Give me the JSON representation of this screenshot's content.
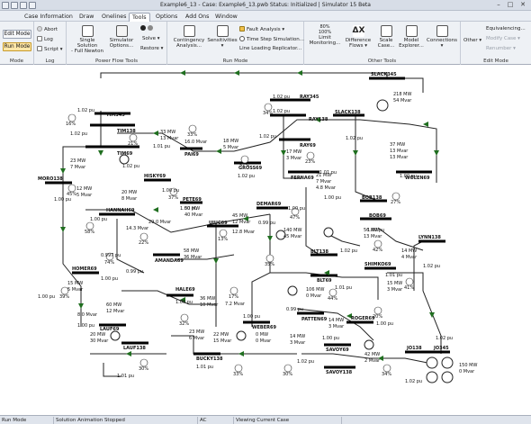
{
  "window": {
    "title": "Example6_13 - Case: Example6_13.pwb  Status: Initialized | Simulator 15 Beta",
    "minimize": "–",
    "maximize": "□",
    "close": "✕"
  },
  "menu": {
    "tabs": [
      {
        "label": "Case Information"
      },
      {
        "label": "Draw"
      },
      {
        "label": "Onelines"
      },
      {
        "label": "Tools"
      },
      {
        "label": "Options"
      },
      {
        "label": "Add Ons"
      },
      {
        "label": "Window"
      }
    ],
    "active": "Tools"
  },
  "ribbon": {
    "mode": {
      "edit": "Edit Mode",
      "run": "Run Mode",
      "group": "Mode"
    },
    "log": {
      "abort": "Abort",
      "log": "Log",
      "script": "Script",
      "group": "Log"
    },
    "powerflow": {
      "single_solution_l1": "Single Solution",
      "single_solution_l2": "- Full Newton",
      "simulator_l1": "Simulator",
      "simulator_l2": "Options...",
      "solve": "Solve",
      "restore": "Restore",
      "group": "Power Flow Tools"
    },
    "runmode": {
      "contingency_l1": "Contingency",
      "contingency_l2": "Analysis...",
      "sensitivities": "Sensitivities",
      "fault_analysis": "Fault Analysis",
      "time_step": "Time Step Simulation...",
      "line_loading": "Line Loading Replicator...",
      "group": "Run Mode"
    },
    "other": {
      "limit_l1": "Limit",
      "limit_l2": "Monitoring...",
      "difference_l1": "Difference",
      "difference_l2": "Flows",
      "scale_l1": "Scale",
      "scale_l2": "Case...",
      "model_l1": "Model",
      "model_l2": "Explorer...",
      "connections": "Connections",
      "pct_top": "80%",
      "pct_bottom": "100%",
      "group": "Other Tools"
    },
    "editmode": {
      "other": "Other",
      "equivalencing": "Equivalencing...",
      "modify_case": "Modify Case",
      "renumber": "Renumber",
      "group": "Edit Mode"
    }
  },
  "status": {
    "mode": "Run Mode",
    "animation": "Solution Animation Stopped",
    "ac": "AC",
    "viewing": "Viewing Current Case"
  },
  "colors": {
    "bus": "#000000",
    "line": "#222222",
    "flow_arrow": "#1f6e1f",
    "active_tab": "#ffffff",
    "run_mode": "#ffe7a8"
  },
  "oneline": {
    "buses": [
      {
        "name": "SLACK345",
        "voltage": ""
      },
      {
        "name": "SLACK138",
        "voltage": "1.02 pu"
      },
      {
        "name": "RAY345",
        "voltage": "1.02 pu"
      },
      {
        "name": "RAY138",
        "voltage": "1.02 pu"
      },
      {
        "name": "RAY69",
        "voltage": "1.02 pu"
      },
      {
        "name": "TIM345",
        "voltage": "1.02 pu"
      },
      {
        "name": "TIM138",
        "voltage": "1.02 pu"
      },
      {
        "name": "TIM69",
        "voltage": "1.02 pu"
      },
      {
        "name": "MORO138",
        "voltage": "1.00 pu"
      },
      {
        "name": "PAI69",
        "voltage": "1.01 pu"
      },
      {
        "name": "GROSS69",
        "voltage": "1.02 pu"
      },
      {
        "name": "FERNA69",
        "voltage": "1.01 pu"
      },
      {
        "name": "WOLEN69",
        "voltage": "1.00 pu"
      },
      {
        "name": "HISKY69",
        "voltage": "1.00 pu"
      },
      {
        "name": "PETE69",
        "voltage": "1.00 pu"
      },
      {
        "name": "HANNAH69",
        "voltage": "1.00 pu"
      },
      {
        "name": "DEMAR69",
        "voltage": "1.00 pu"
      },
      {
        "name": "BOB138",
        "voltage": "1.00 pu"
      },
      {
        "name": "BOB69",
        "voltage": "1.00 pu"
      },
      {
        "name": "UIUC69",
        "voltage": "0.99 pu"
      },
      {
        "name": "LYNN138",
        "voltage": "1.02 pu"
      },
      {
        "name": "AMANDA69",
        "voltage": "0.99 pu"
      },
      {
        "name": "BLT138",
        "voltage": "1.02 pu"
      },
      {
        "name": "BLT69",
        "voltage": "1.01 pu"
      },
      {
        "name": "HOMER69",
        "voltage": "1.00 pu"
      },
      {
        "name": "SHIMKO69",
        "voltage": "1.01 pu"
      },
      {
        "name": "HALE69",
        "voltage": "1.00 pu"
      },
      {
        "name": "PATTEN69",
        "voltage": "0.99 pu"
      },
      {
        "name": "WEBER69",
        "voltage": "1.00 pu"
      },
      {
        "name": "ROGER69",
        "voltage": "1.00 pu"
      },
      {
        "name": "LAUF69",
        "voltage": "1.00 pu"
      },
      {
        "name": "LAUF138",
        "voltage": "1.01 pu"
      },
      {
        "name": "SAVOY69",
        "voltage": "1.00 pu"
      },
      {
        "name": "SAVOY138",
        "voltage": "1.02 pu"
      },
      {
        "name": "BUCKY138",
        "voltage": "1.01 pu"
      },
      {
        "name": "JO138",
        "voltage": "1.02 pu"
      },
      {
        "name": "JO345",
        "voltage": "1.02 pu"
      }
    ],
    "labels": [
      "218 MW",
      "54 Mvar",
      "33 MW",
      "13 Mvar",
      "16.0 Mvar",
      "18 MW",
      "5 Mvar",
      "17 MW",
      "3 Mvar",
      "37 MW",
      "13 Mvar",
      "13 Mvar",
      "23 MW",
      "7 Mvar",
      "21 MW",
      "7 Mvar",
      "4.8 Mvar",
      "12 MW",
      "5 Mvar",
      "20 MW",
      "8 Mvar",
      "29.0 Mvar",
      "14.3 Mvar",
      "50 MW",
      "40 Mvar",
      "45 MW",
      "12 Mvar",
      "12.8 Mvar",
      "140 MW",
      "45 Mvar",
      "56 MW",
      "13 Mvar",
      "14 MW",
      "4 Mvar",
      "58 MW",
      "36 Mvar",
      "15 MW",
      "5 Mvar",
      "15 MW",
      "3 Mvar",
      "106 MW",
      "0 Mvar",
      "36 MW",
      "10 Mvar",
      "7.2 Mvar",
      "60 MW",
      "12 Mvar",
      "8.0 Mvar",
      "14 MW",
      "3 Mvar",
      "20 MW",
      "30 Mvar",
      "23 MW",
      "6 Mvar",
      "22 MW",
      "15 Mvar",
      "0 MW",
      "0 Mvar",
      "14 MW",
      "3 Mvar",
      "42 MW",
      "2 Mvar",
      "150 MW",
      "0 Mvar",
      "0.997 pu",
      "1.00 pu"
    ],
    "percents": [
      "16%",
      "33%",
      "34%",
      "21%",
      "57%",
      "45%",
      "27%",
      "37%",
      "47%",
      "58%",
      "13%",
      "42%",
      "74%",
      "35%",
      "41%",
      "39%",
      "17%",
      "44%",
      "32%",
      "20%",
      "30%",
      "33%",
      "30%",
      "34%",
      "23%",
      "22%"
    ]
  }
}
